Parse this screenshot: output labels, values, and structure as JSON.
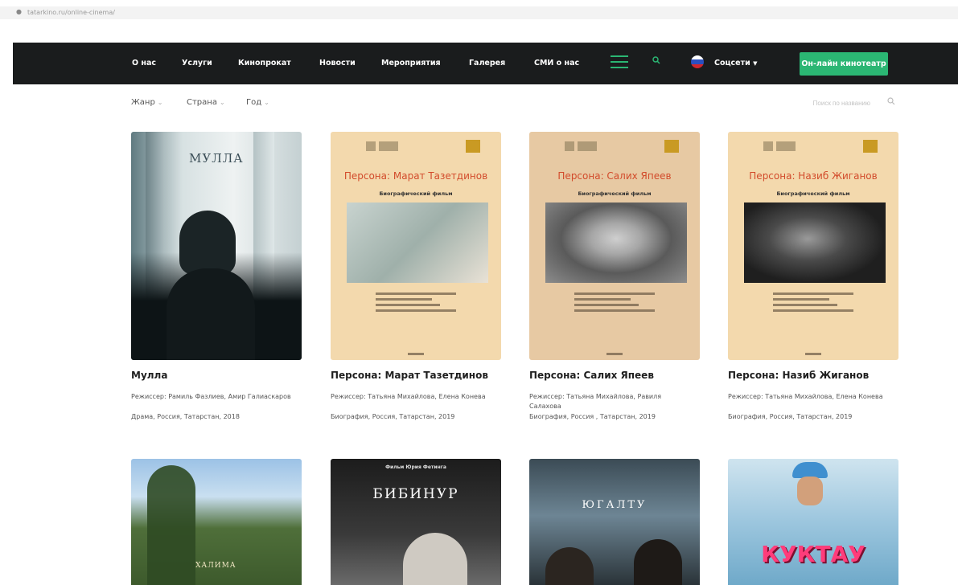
{
  "browser": {
    "url": "tatarkino.ru/online-cinema/"
  },
  "nav": {
    "items": [
      "О нас",
      "Услуги",
      "Кинопрокат",
      "Новости",
      "Мероприятия",
      "Галерея",
      "СМИ о нас"
    ],
    "socials": "Соцсети",
    "cta": "Он-лайн кинотеатр",
    "accent": "#2bb673",
    "background": "#1a1c1d"
  },
  "filters": {
    "genre": "Жанр",
    "country": "Страна",
    "year": "Год",
    "search_placeholder": "Поиск по названию"
  },
  "films": [
    {
      "title": "Мулла",
      "director": "Режиссер: Рамиль Фазлиев, Амир Галиаскаров",
      "meta": "Драма, Россия, Татарстан, 2018",
      "poster_text": "МУЛЛА"
    },
    {
      "title": "Персона: Марат Тазетдинов",
      "director": "Режиссер: Татьяна Михайлова, Елена Конева",
      "meta": "Биография, Россия, Татарстан, 2019",
      "poster_text": "Персона: Марат Тазетдинов",
      "poster_sub": "Биографический фильм"
    },
    {
      "title": "Персона: Салих Япеев",
      "director": "Режиссер: Татьяна Михайлова, Равиля Салахова",
      "meta": "Биография, Россия , Татарстан, 2019",
      "poster_text": "Персона: Салих Япеев",
      "poster_sub": "Биографический фильм"
    },
    {
      "title": "Персона: Назиб Жиганов",
      "director": "Режиссер: Татьяна Михайлова, Елена Конева",
      "meta": "Биография, Россия, Татарстан, 2019",
      "poster_text": "Персона: Назиб Жиганов",
      "poster_sub": "Биографический фильм"
    }
  ],
  "row2": [
    {
      "poster_text": "ХАЛИМА"
    },
    {
      "poster_text": "БИБИНУР",
      "poster_top": "Фильм Юрия Фетинга"
    },
    {
      "poster_text": "ЮГАЛТУ"
    },
    {
      "poster_text": "КУКТАУ"
    }
  ]
}
